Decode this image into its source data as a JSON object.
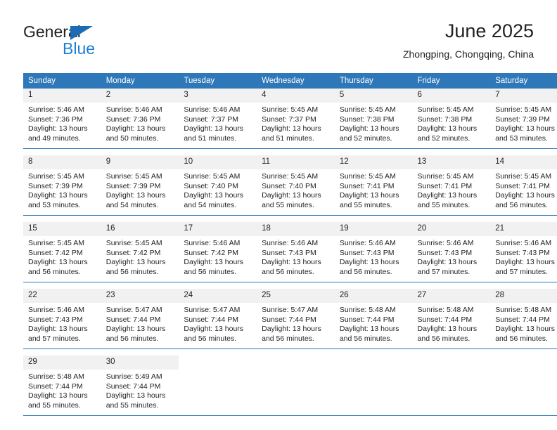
{
  "logo": {
    "name_part1": "General",
    "name_part2": "Blue",
    "triangle_color": "#1b6cb5",
    "blue_color": "#1b7fd4"
  },
  "header": {
    "title": "June 2025",
    "subtitle": "Zhongping, Chongqing, China"
  },
  "theme": {
    "header_bg": "#2e77b8",
    "daynum_bg": "#f1f1f1",
    "text_color": "#231f20",
    "rule_color": "#2e77b8"
  },
  "calendar": {
    "weekday_headers": [
      "Sunday",
      "Monday",
      "Tuesday",
      "Wednesday",
      "Thursday",
      "Friday",
      "Saturday"
    ],
    "weeks": [
      [
        {
          "day": "1",
          "sunrise": "Sunrise: 5:46 AM",
          "sunset": "Sunset: 7:36 PM",
          "daylight_line1": "Daylight: 13 hours",
          "daylight_line2": "and 49 minutes."
        },
        {
          "day": "2",
          "sunrise": "Sunrise: 5:46 AM",
          "sunset": "Sunset: 7:36 PM",
          "daylight_line1": "Daylight: 13 hours",
          "daylight_line2": "and 50 minutes."
        },
        {
          "day": "3",
          "sunrise": "Sunrise: 5:46 AM",
          "sunset": "Sunset: 7:37 PM",
          "daylight_line1": "Daylight: 13 hours",
          "daylight_line2": "and 51 minutes."
        },
        {
          "day": "4",
          "sunrise": "Sunrise: 5:45 AM",
          "sunset": "Sunset: 7:37 PM",
          "daylight_line1": "Daylight: 13 hours",
          "daylight_line2": "and 51 minutes."
        },
        {
          "day": "5",
          "sunrise": "Sunrise: 5:45 AM",
          "sunset": "Sunset: 7:38 PM",
          "daylight_line1": "Daylight: 13 hours",
          "daylight_line2": "and 52 minutes."
        },
        {
          "day": "6",
          "sunrise": "Sunrise: 5:45 AM",
          "sunset": "Sunset: 7:38 PM",
          "daylight_line1": "Daylight: 13 hours",
          "daylight_line2": "and 52 minutes."
        },
        {
          "day": "7",
          "sunrise": "Sunrise: 5:45 AM",
          "sunset": "Sunset: 7:39 PM",
          "daylight_line1": "Daylight: 13 hours",
          "daylight_line2": "and 53 minutes."
        }
      ],
      [
        {
          "day": "8",
          "sunrise": "Sunrise: 5:45 AM",
          "sunset": "Sunset: 7:39 PM",
          "daylight_line1": "Daylight: 13 hours",
          "daylight_line2": "and 53 minutes."
        },
        {
          "day": "9",
          "sunrise": "Sunrise: 5:45 AM",
          "sunset": "Sunset: 7:39 PM",
          "daylight_line1": "Daylight: 13 hours",
          "daylight_line2": "and 54 minutes."
        },
        {
          "day": "10",
          "sunrise": "Sunrise: 5:45 AM",
          "sunset": "Sunset: 7:40 PM",
          "daylight_line1": "Daylight: 13 hours",
          "daylight_line2": "and 54 minutes."
        },
        {
          "day": "11",
          "sunrise": "Sunrise: 5:45 AM",
          "sunset": "Sunset: 7:40 PM",
          "daylight_line1": "Daylight: 13 hours",
          "daylight_line2": "and 55 minutes."
        },
        {
          "day": "12",
          "sunrise": "Sunrise: 5:45 AM",
          "sunset": "Sunset: 7:41 PM",
          "daylight_line1": "Daylight: 13 hours",
          "daylight_line2": "and 55 minutes."
        },
        {
          "day": "13",
          "sunrise": "Sunrise: 5:45 AM",
          "sunset": "Sunset: 7:41 PM",
          "daylight_line1": "Daylight: 13 hours",
          "daylight_line2": "and 55 minutes."
        },
        {
          "day": "14",
          "sunrise": "Sunrise: 5:45 AM",
          "sunset": "Sunset: 7:41 PM",
          "daylight_line1": "Daylight: 13 hours",
          "daylight_line2": "and 56 minutes."
        }
      ],
      [
        {
          "day": "15",
          "sunrise": "Sunrise: 5:45 AM",
          "sunset": "Sunset: 7:42 PM",
          "daylight_line1": "Daylight: 13 hours",
          "daylight_line2": "and 56 minutes."
        },
        {
          "day": "16",
          "sunrise": "Sunrise: 5:45 AM",
          "sunset": "Sunset: 7:42 PM",
          "daylight_line1": "Daylight: 13 hours",
          "daylight_line2": "and 56 minutes."
        },
        {
          "day": "17",
          "sunrise": "Sunrise: 5:46 AM",
          "sunset": "Sunset: 7:42 PM",
          "daylight_line1": "Daylight: 13 hours",
          "daylight_line2": "and 56 minutes."
        },
        {
          "day": "18",
          "sunrise": "Sunrise: 5:46 AM",
          "sunset": "Sunset: 7:43 PM",
          "daylight_line1": "Daylight: 13 hours",
          "daylight_line2": "and 56 minutes."
        },
        {
          "day": "19",
          "sunrise": "Sunrise: 5:46 AM",
          "sunset": "Sunset: 7:43 PM",
          "daylight_line1": "Daylight: 13 hours",
          "daylight_line2": "and 56 minutes."
        },
        {
          "day": "20",
          "sunrise": "Sunrise: 5:46 AM",
          "sunset": "Sunset: 7:43 PM",
          "daylight_line1": "Daylight: 13 hours",
          "daylight_line2": "and 57 minutes."
        },
        {
          "day": "21",
          "sunrise": "Sunrise: 5:46 AM",
          "sunset": "Sunset: 7:43 PM",
          "daylight_line1": "Daylight: 13 hours",
          "daylight_line2": "and 57 minutes."
        }
      ],
      [
        {
          "day": "22",
          "sunrise": "Sunrise: 5:46 AM",
          "sunset": "Sunset: 7:43 PM",
          "daylight_line1": "Daylight: 13 hours",
          "daylight_line2": "and 57 minutes."
        },
        {
          "day": "23",
          "sunrise": "Sunrise: 5:47 AM",
          "sunset": "Sunset: 7:44 PM",
          "daylight_line1": "Daylight: 13 hours",
          "daylight_line2": "and 56 minutes."
        },
        {
          "day": "24",
          "sunrise": "Sunrise: 5:47 AM",
          "sunset": "Sunset: 7:44 PM",
          "daylight_line1": "Daylight: 13 hours",
          "daylight_line2": "and 56 minutes."
        },
        {
          "day": "25",
          "sunrise": "Sunrise: 5:47 AM",
          "sunset": "Sunset: 7:44 PM",
          "daylight_line1": "Daylight: 13 hours",
          "daylight_line2": "and 56 minutes."
        },
        {
          "day": "26",
          "sunrise": "Sunrise: 5:48 AM",
          "sunset": "Sunset: 7:44 PM",
          "daylight_line1": "Daylight: 13 hours",
          "daylight_line2": "and 56 minutes."
        },
        {
          "day": "27",
          "sunrise": "Sunrise: 5:48 AM",
          "sunset": "Sunset: 7:44 PM",
          "daylight_line1": "Daylight: 13 hours",
          "daylight_line2": "and 56 minutes."
        },
        {
          "day": "28",
          "sunrise": "Sunrise: 5:48 AM",
          "sunset": "Sunset: 7:44 PM",
          "daylight_line1": "Daylight: 13 hours",
          "daylight_line2": "and 56 minutes."
        }
      ],
      [
        {
          "day": "29",
          "sunrise": "Sunrise: 5:48 AM",
          "sunset": "Sunset: 7:44 PM",
          "daylight_line1": "Daylight: 13 hours",
          "daylight_line2": "and 55 minutes."
        },
        {
          "day": "30",
          "sunrise": "Sunrise: 5:49 AM",
          "sunset": "Sunset: 7:44 PM",
          "daylight_line1": "Daylight: 13 hours",
          "daylight_line2": "and 55 minutes."
        },
        {
          "day": "",
          "sunrise": "",
          "sunset": "",
          "daylight_line1": "",
          "daylight_line2": ""
        },
        {
          "day": "",
          "sunrise": "",
          "sunset": "",
          "daylight_line1": "",
          "daylight_line2": ""
        },
        {
          "day": "",
          "sunrise": "",
          "sunset": "",
          "daylight_line1": "",
          "daylight_line2": ""
        },
        {
          "day": "",
          "sunrise": "",
          "sunset": "",
          "daylight_line1": "",
          "daylight_line2": ""
        },
        {
          "day": "",
          "sunrise": "",
          "sunset": "",
          "daylight_line1": "",
          "daylight_line2": ""
        }
      ]
    ]
  }
}
